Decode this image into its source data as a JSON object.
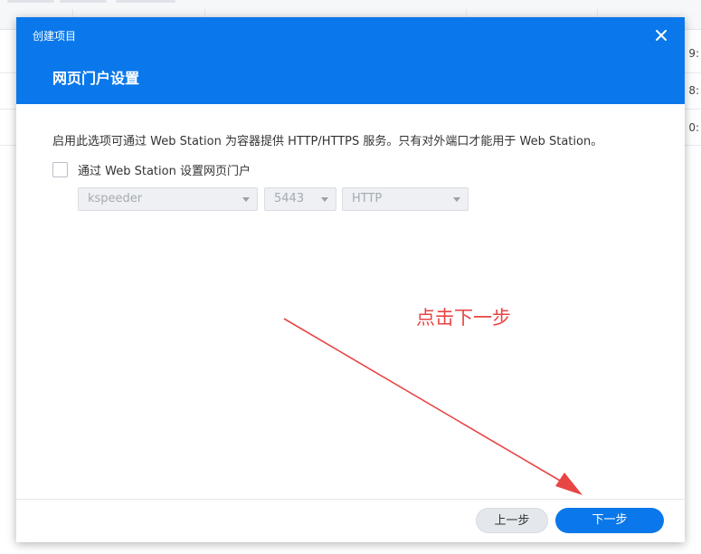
{
  "dialog": {
    "title": "创建项目",
    "heading": "网页门户设置",
    "description": "启用此选项可通过 Web Station 为容器提供 HTTP/HTTPS 服务。只有对外端口才能用于 Web Station。",
    "checkbox_label": "通过 Web Station 设置网页门户",
    "checkbox_checked": false,
    "selects": {
      "container": "kspeeder",
      "port": "5443",
      "protocol": "HTTP"
    },
    "buttons": {
      "prev": "上一步",
      "next": "下一步"
    }
  },
  "annotation": {
    "text": "点击下一步",
    "color": "#e84545"
  },
  "background": {
    "cells": [
      "9:",
      "8:",
      "0:"
    ]
  },
  "colors": {
    "accent": "#0a78ea",
    "annotation": "#e84545"
  }
}
